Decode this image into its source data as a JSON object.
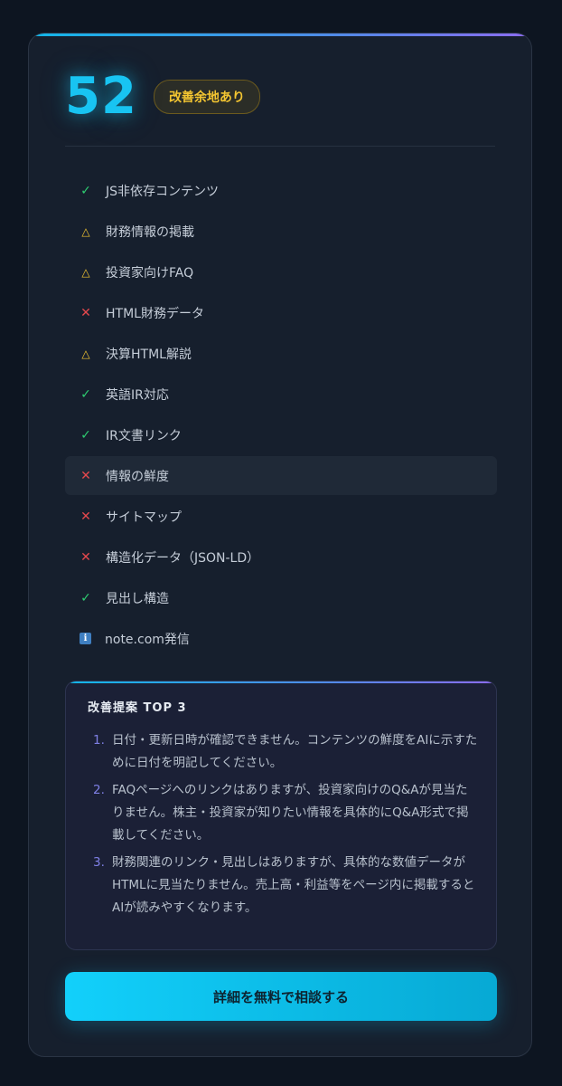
{
  "score": {
    "value": "52",
    "badge": "改善余地あり"
  },
  "colors": {
    "accent": "#18c4f2",
    "ok": "#2ecc71",
    "warn": "#f3c531",
    "ng": "#e5484d",
    "info": "#3f7fc1",
    "suggest_number": "#7f80e6"
  },
  "checklist": [
    {
      "status": "ok",
      "icon": "check-icon",
      "glyph": "✓",
      "label": "JS非依存コンテンツ"
    },
    {
      "status": "warn",
      "icon": "warning-triangle-icon",
      "glyph": "△",
      "label": "財務情報の掲載"
    },
    {
      "status": "warn",
      "icon": "warning-triangle-icon",
      "glyph": "△",
      "label": "投資家向けFAQ"
    },
    {
      "status": "ng",
      "icon": "cross-icon",
      "glyph": "✕",
      "label": "HTML財務データ"
    },
    {
      "status": "warn",
      "icon": "warning-triangle-icon",
      "glyph": "△",
      "label": "決算HTML解説"
    },
    {
      "status": "ok",
      "icon": "check-icon",
      "glyph": "✓",
      "label": "英語IR対応"
    },
    {
      "status": "ok",
      "icon": "check-icon",
      "glyph": "✓",
      "label": "IR文書リンク"
    },
    {
      "status": "ng",
      "icon": "cross-icon",
      "glyph": "✕",
      "label": "情報の鮮度"
    },
    {
      "status": "ng",
      "icon": "cross-icon",
      "glyph": "✕",
      "label": "サイトマップ"
    },
    {
      "status": "ng",
      "icon": "cross-icon",
      "glyph": "✕",
      "label": "構造化データ（JSON-LD）"
    },
    {
      "status": "ok",
      "icon": "check-icon",
      "glyph": "✓",
      "label": "見出し構造"
    },
    {
      "status": "info",
      "icon": "info-icon",
      "glyph": "i",
      "label": "note.com発信"
    }
  ],
  "suggestions": {
    "title": "改善提案 TOP 3",
    "items": [
      {
        "num": "1.",
        "text": "日付・更新日時が確認できません。コンテンツの鮮度をAIに示すために日付を明記してください。"
      },
      {
        "num": "2.",
        "text": "FAQページへのリンクはありますが、投資家向けのQ&Aが見当たりません。株主・投資家が知りたい情報を具体的にQ&A形式で掲載してください。"
      },
      {
        "num": "3.",
        "text": "財務関連のリンク・見出しはありますが、具体的な数値データがHTMLに見当たりません。売上高・利益等をページ内に掲載するとAIが読みやすくなります。"
      }
    ]
  },
  "cta": {
    "label": "詳細を無料で相談する"
  }
}
